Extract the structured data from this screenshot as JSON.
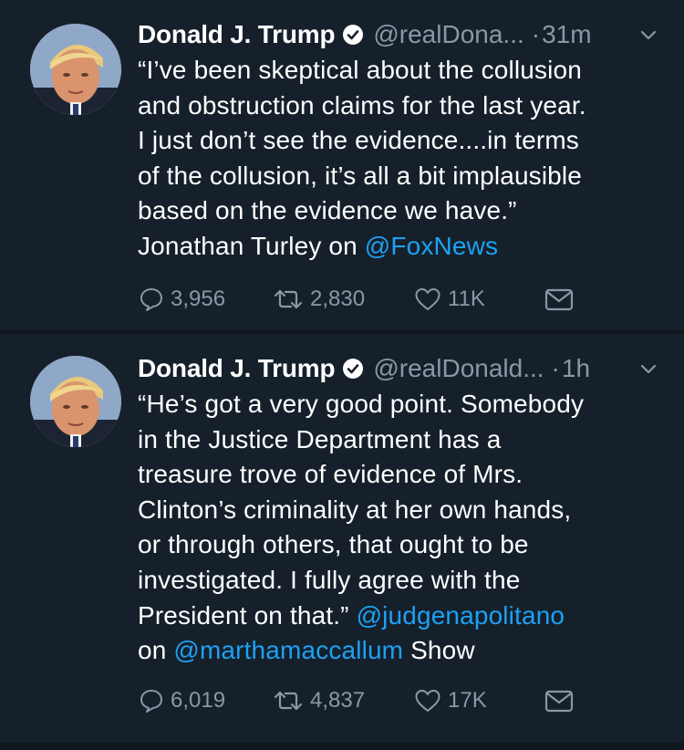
{
  "colors": {
    "background": "#10171e",
    "card": "#15202b",
    "text": "#ffffff",
    "secondary": "#8899a6",
    "link": "#1da1f2"
  },
  "tweets": [
    {
      "name": "Donald J. Trump",
      "handle": "@realDona...",
      "separator": "·",
      "time": "31m",
      "text_lines": [
        "“I’ve been skeptical about the collusion",
        "and obstruction claims for the last year.",
        "I just don’t see the evidence....in terms",
        "of the collusion, it’s all a bit implausible",
        "based on the evidence we have.”"
      ],
      "last_line_prefix": "Jonathan Turley on ",
      "last_line_mention": "@FoxNews",
      "replies": "3,956",
      "retweets": "2,830",
      "likes": "11K",
      "icons": [
        "verified-badge-icon",
        "chevron-down-icon",
        "reply-icon",
        "retweet-icon",
        "like-icon",
        "direct-message-icon"
      ]
    },
    {
      "name": "Donald J. Trump",
      "handle": "@realDonald...",
      "separator": "·",
      "time": "1h",
      "text_lines": [
        "“He’s got a very good point. Somebody",
        "in the Justice Department has a",
        "treasure trove of evidence of Mrs.",
        "Clinton’s criminality at her own hands,",
        "or through others, that ought to be",
        "investigated. I fully agree with the"
      ],
      "line7_prefix": "President on that.” ",
      "line7_mention": "@judgenapolitano",
      "line8_prefix": "on ",
      "line8_mention": "@marthamaccallum",
      "line8_suffix": " Show",
      "replies": "6,019",
      "retweets": "4,837",
      "likes": "17K",
      "icons": [
        "verified-badge-icon",
        "chevron-down-icon",
        "reply-icon",
        "retweet-icon",
        "like-icon",
        "direct-message-icon"
      ]
    }
  ]
}
